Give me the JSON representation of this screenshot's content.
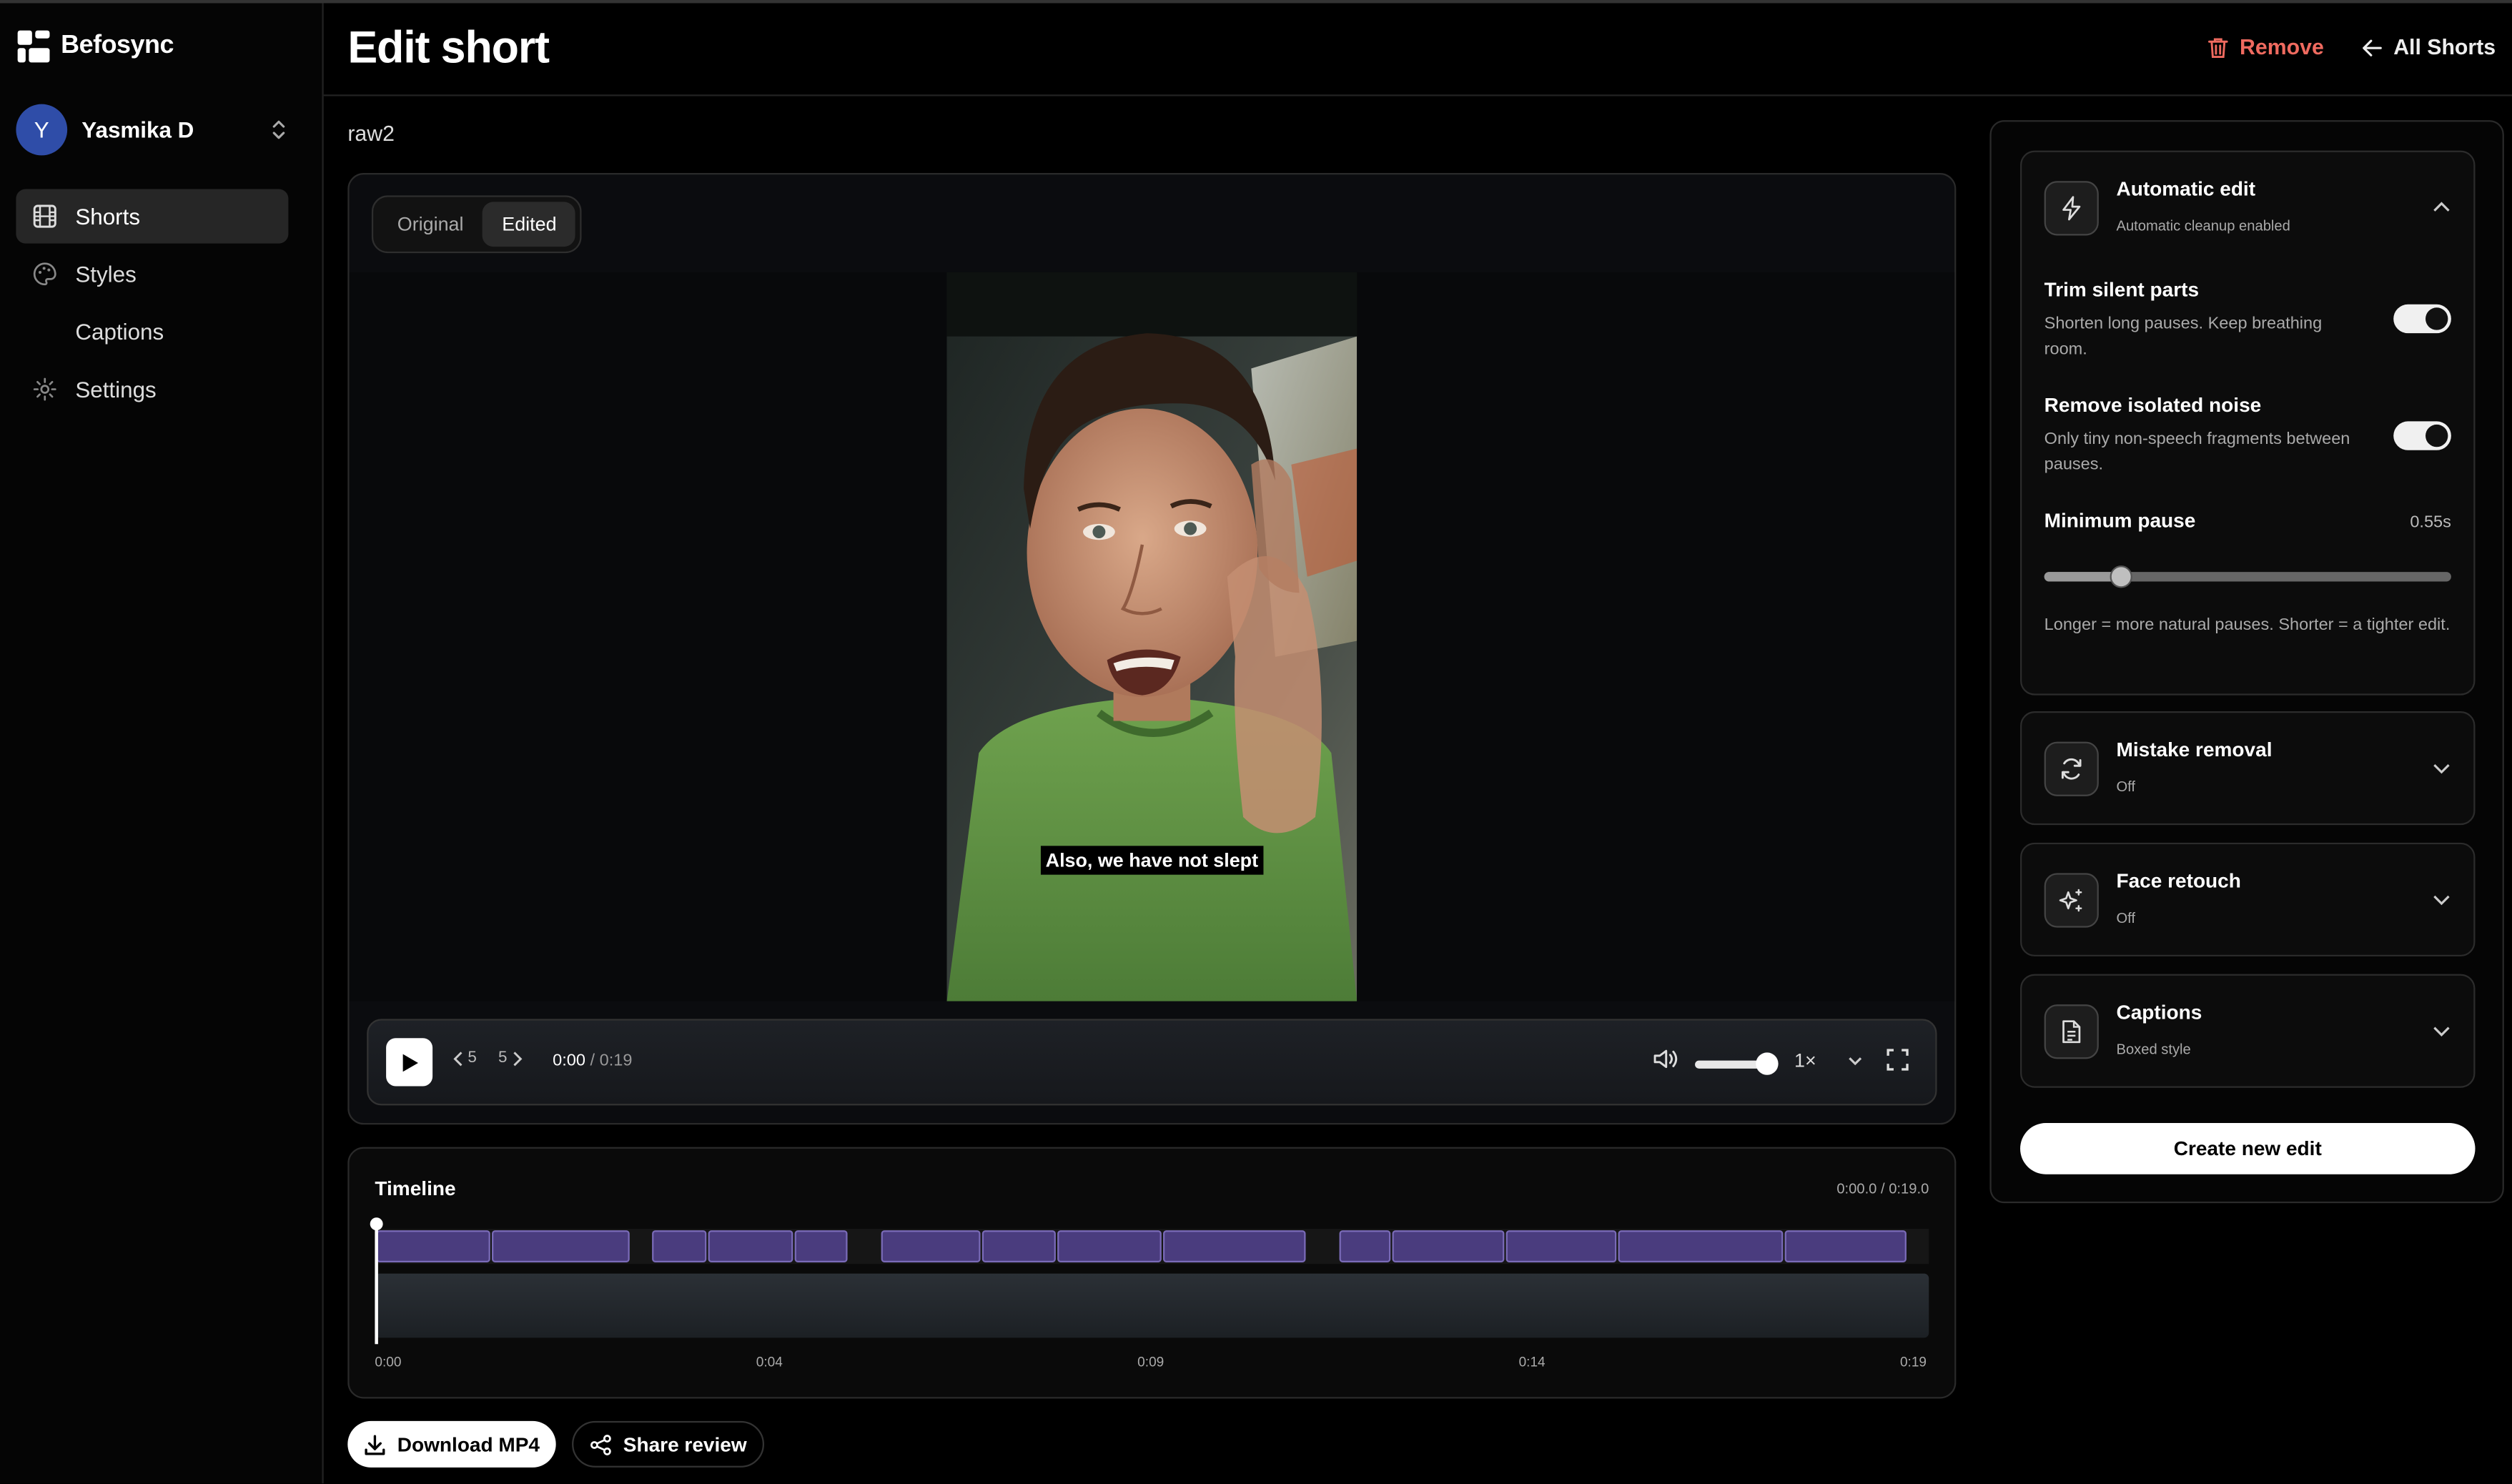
{
  "app": {
    "name": "Befosync"
  },
  "user": {
    "initial": "Y",
    "name": "Yasmika D"
  },
  "nav": {
    "shorts": "Shorts",
    "styles": "Styles",
    "captions": "Captions",
    "settings": "Settings"
  },
  "header": {
    "title": "Edit short",
    "remove": "Remove",
    "all_shorts": "All Shorts"
  },
  "file": {
    "name": "raw2"
  },
  "player": {
    "mode_original": "Original",
    "mode_edited": "Edited",
    "caption": "Also, we have not slept",
    "skip_back": "5",
    "skip_forward": "5",
    "time_current": "0:00",
    "time_total": "/ 0:19",
    "speed": "1×",
    "volume_level": 0.85
  },
  "timeline": {
    "title": "Timeline",
    "time": "0:00.0 / 0:19.0",
    "ticks": [
      "0:00",
      "0:04",
      "0:09",
      "0:14",
      "0:19"
    ],
    "playhead_seconds": 0,
    "duration_seconds": 19
  },
  "actions": {
    "download": "Download MP4",
    "share": "Share review"
  },
  "panel": {
    "auto": {
      "title": "Automatic edit",
      "subtitle": "Automatic cleanup enabled",
      "trim_title": "Trim silent parts",
      "trim_desc": "Shorten long pauses. Keep breathing room.",
      "noise_title": "Remove isolated noise",
      "noise_desc": "Only tiny non-speech fragments between pauses.",
      "pause_label": "Minimum pause",
      "pause_value": "0.55s",
      "pause_help": "Longer = more natural pauses. Shorter = a tighter edit."
    },
    "mistake": {
      "title": "Mistake removal",
      "subtitle": "Off"
    },
    "face": {
      "title": "Face retouch",
      "subtitle": "Off"
    },
    "captions": {
      "title": "Captions",
      "subtitle": "Boxed style"
    },
    "create": "Create new edit"
  },
  "colors": {
    "accent_danger": "#ef6a5f",
    "clip_fill": "#4a3c7e",
    "clip_border": "#7a6bb8",
    "avatar": "#2f4da8"
  }
}
